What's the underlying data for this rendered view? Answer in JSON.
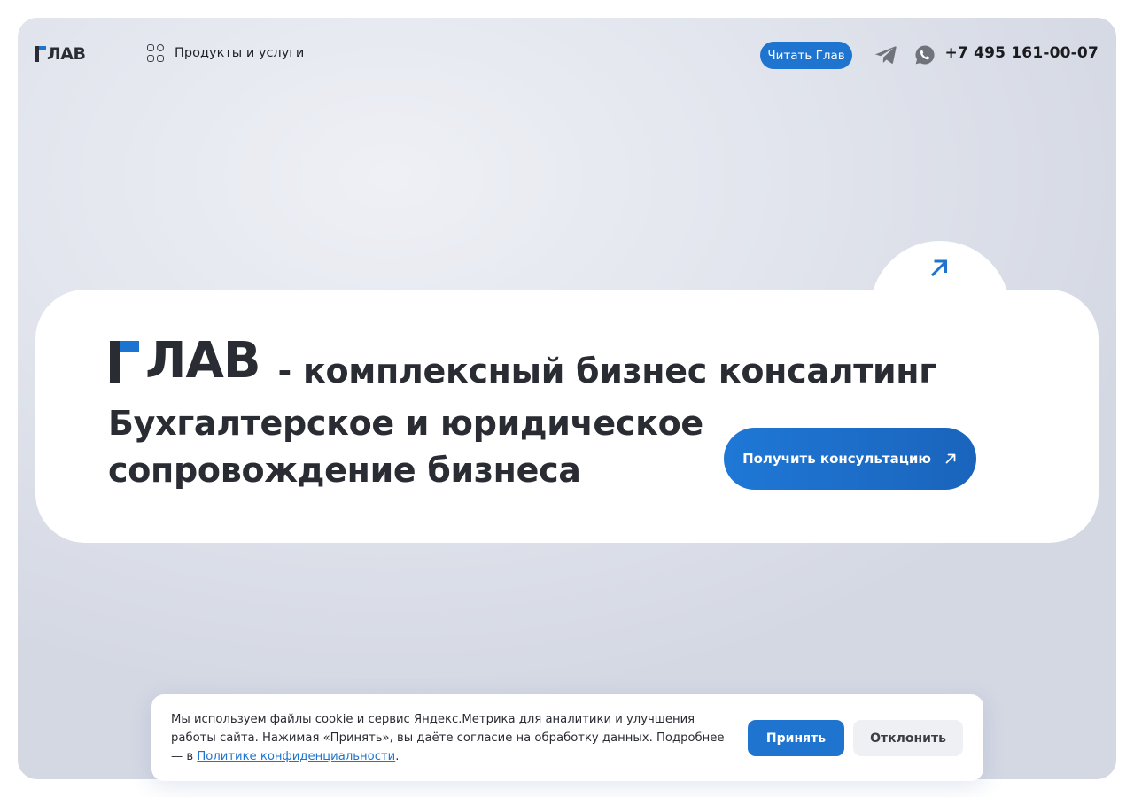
{
  "header": {
    "logo_text": "ЛАВ",
    "products_label": "Продукты и услуги",
    "read_button_label": "Читать Глав",
    "phone": "+7 495 161-00-07",
    "icons": [
      "telegram-icon",
      "whatsapp-icon",
      "grid-icon"
    ]
  },
  "hero": {
    "logo_text": "ЛАВ",
    "title_rest": "- комплексный бизнес консалтинг",
    "subtitle": "Бухгалтерское и юридическое сопровождение бизнеса",
    "cta_label": "Получить консультацию"
  },
  "cookie": {
    "text": "Мы используем файлы cookie и сервис Яндекс.Метрика для аналитики и улучшения работы сайта. Нажимая «Принять», вы даёте согласие на обработку данных. Подробнее — в ",
    "policy_link": "Политике конфиденциальности",
    "text_end": ".",
    "accept_label": "Принять",
    "decline_label": "Отклонить"
  },
  "colors": {
    "accent": "#1e74cf",
    "text_dark": "#2a2c33",
    "background": "#e3e6ee"
  }
}
